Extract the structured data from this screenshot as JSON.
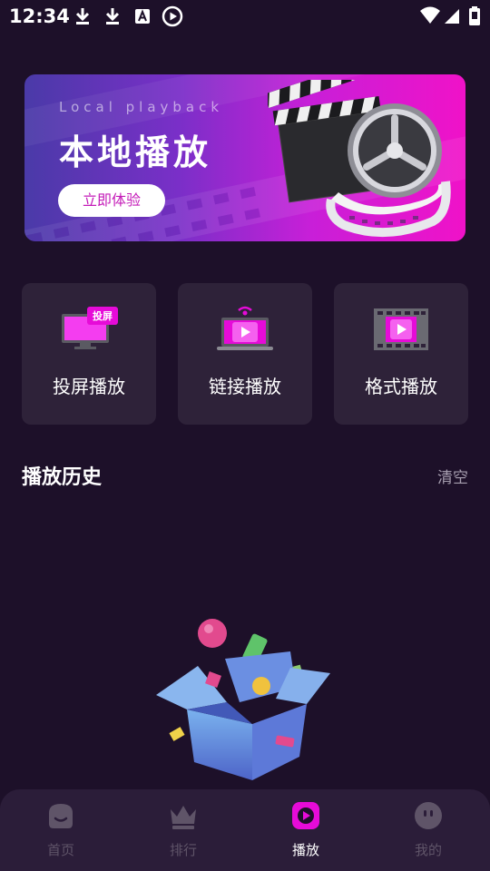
{
  "status_bar": {
    "time": "12:34",
    "icons_left": [
      "download-icon",
      "download-icon",
      "font-a-icon",
      "play-circle-icon"
    ],
    "icons_right": [
      "wifi-icon",
      "signal-icon",
      "battery-icon"
    ]
  },
  "banner": {
    "subtitle": "Local playback",
    "title": "本地播放",
    "button_label": "立即体验",
    "gradient_colors": [
      "#4a3aa8",
      "#f012c8"
    ]
  },
  "cards": [
    {
      "label": "投屏播放",
      "badge": "投屏",
      "icon": "cast-screen-icon"
    },
    {
      "label": "链接播放",
      "icon": "link-laptop-icon"
    },
    {
      "label": "格式播放",
      "icon": "film-format-icon"
    }
  ],
  "history": {
    "title": "播放历史",
    "clear_label": "清空"
  },
  "nav": {
    "items": [
      {
        "label": "首页",
        "icon": "home-face-icon",
        "active": false
      },
      {
        "label": "排行",
        "icon": "crown-icon",
        "active": false
      },
      {
        "label": "播放",
        "icon": "play-icon",
        "active": true
      },
      {
        "label": "我的",
        "icon": "profile-face-icon",
        "active": false
      }
    ]
  },
  "colors": {
    "background": "#1d1029",
    "card": "#2e2239",
    "accent": "#e60bd8",
    "nav_inactive": "#5f5468"
  }
}
